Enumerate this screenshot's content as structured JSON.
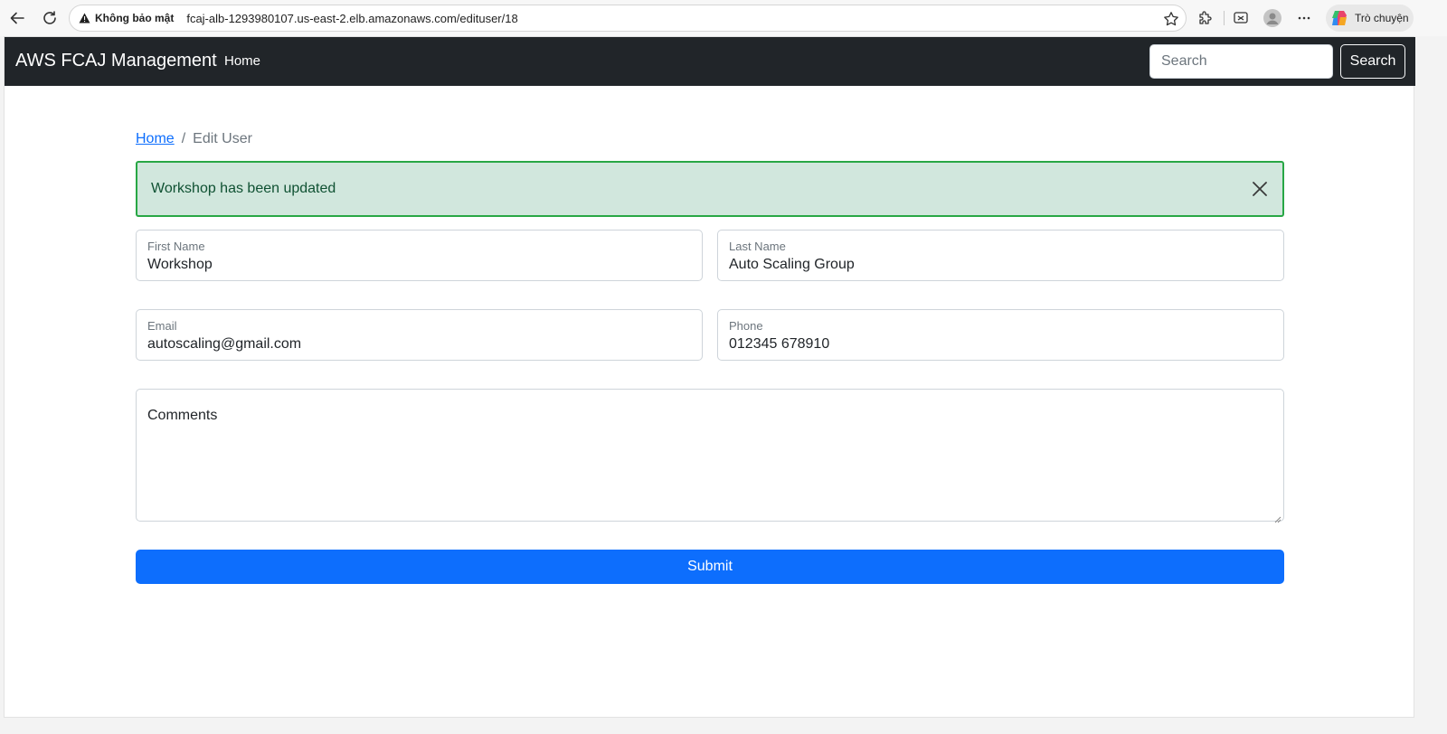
{
  "browser": {
    "security_label": "Không bảo mật",
    "url": "fcaj-alb-1293980107.us-east-2.elb.amazonaws.com/edituser/18",
    "copilot_label": "Trò chuyện"
  },
  "navbar": {
    "brand": "AWS FCAJ Management",
    "home_link": "Home",
    "search_placeholder": "Search",
    "search_button": "Search",
    "background": "#212529"
  },
  "breadcrumb": {
    "home": "Home",
    "separator": "/",
    "current": "Edit User"
  },
  "alert": {
    "message": "Workshop has been updated",
    "background": "#d1e7dd",
    "border": "#28a745"
  },
  "form": {
    "first_name": {
      "label": "First Name",
      "value": "Workshop"
    },
    "last_name": {
      "label": "Last Name",
      "value": "Auto Scaling Group"
    },
    "email": {
      "label": "Email",
      "value": "autoscaling@gmail.com"
    },
    "phone": {
      "label": "Phone",
      "value": "012345 678910"
    },
    "comments": {
      "label": "Comments",
      "value": ""
    },
    "submit_label": "Submit",
    "submit_color": "#0d6efd"
  }
}
